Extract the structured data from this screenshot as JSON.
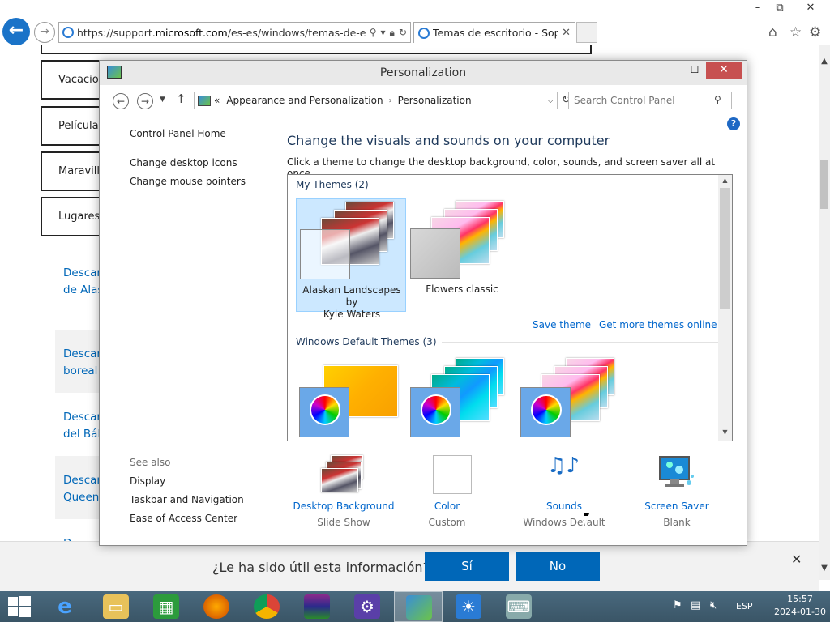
{
  "ie": {
    "url_prefix": "https://support.",
    "url_domain": "microsoft.com",
    "url_suffix": "/es-es/windows/temas-de-escrito",
    "tab_title": "Temas de escritorio - Sopor...",
    "min": "–",
    "max": "⧉",
    "close": "✕"
  },
  "webpage": {
    "categories": [
      "Vacacion",
      "Películas",
      "Maravilla",
      "Lugares y"
    ],
    "downloads": [
      {
        "line1": "Descarg",
        "line2": "de Alas"
      },
      {
        "line1": "Descarg",
        "line2": "boreal"
      },
      {
        "line1": "Descarg",
        "line2": "del Bált"
      },
      {
        "line1": "Descarg",
        "line2": "Queens"
      },
      {
        "line1": "D",
        "line2": ""
      }
    ]
  },
  "feedback": {
    "question": "¿Le ha sido útil esta información?",
    "yes": "Sí",
    "no": "No",
    "close": "✕"
  },
  "window": {
    "title": "Personalization",
    "min": "—",
    "max": "☐",
    "close": "✕",
    "nav": {
      "path_prefix": "«",
      "path_1": "Appearance and Personalization",
      "path_sep": "›",
      "path_2": "Personalization",
      "search_placeholder": "Search Control Panel"
    },
    "left": {
      "home": "Control Panel Home",
      "desktop_icons": "Change desktop icons",
      "mouse_pointers": "Change mouse pointers",
      "see_also": "See also",
      "display": "Display",
      "taskbar": "Taskbar and Navigation",
      "ease": "Ease of Access Center"
    },
    "main": {
      "heading": "Change the visuals and sounds on your computer",
      "subheading": "Click a theme to change the desktop background, color, sounds, and screen saver all at once.",
      "my_themes": "My Themes (2)",
      "windows_themes": "Windows Default Themes (3)",
      "themes": [
        {
          "name_line1": "Alaskan Landscapes by",
          "name_line2": "Kyle Waters",
          "selected": true
        },
        {
          "name_line1": "Flowers classic",
          "name_line2": "",
          "selected": false
        }
      ],
      "save_theme": "Save theme",
      "more_themes": "Get more themes online"
    },
    "settings": [
      {
        "link": "Desktop Background",
        "value": "Slide Show"
      },
      {
        "link": "Color",
        "value": "Custom"
      },
      {
        "link": "Sounds",
        "value": "Windows Default"
      },
      {
        "link": "Screen Saver",
        "value": "Blank"
      }
    ]
  },
  "taskbar": {
    "apps": [
      "internet-explorer",
      "file-explorer",
      "store",
      "firefox",
      "chrome",
      "winrar",
      "settings",
      "control-panel",
      "weather",
      "keyboard"
    ],
    "lang": "ESP",
    "time": "15:57",
    "date": "2024-01-30"
  }
}
